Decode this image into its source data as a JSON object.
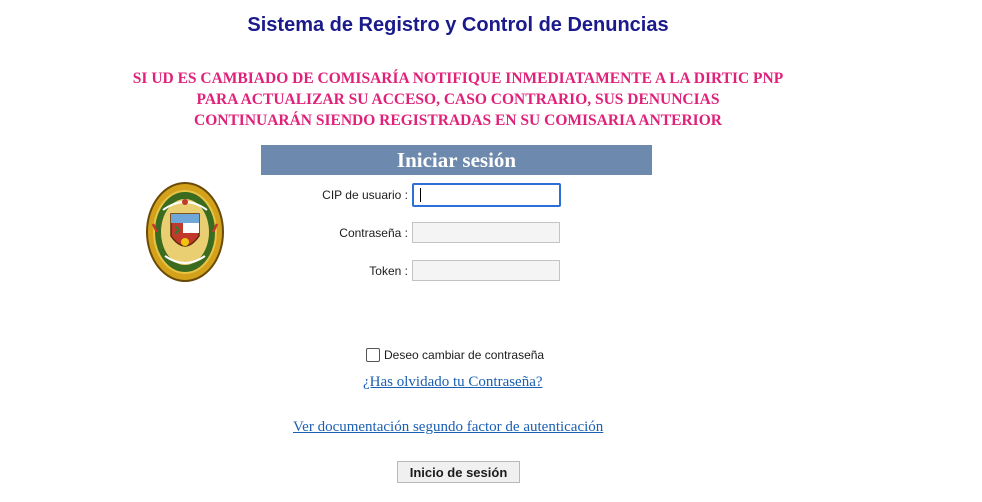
{
  "header": {
    "app_title": "Sistema de Registro y Control de Denuncias"
  },
  "notice": {
    "lines": [
      "SI UD ES CAMBIADO DE COMISARÍA NOTIFIQUE INMEDIATAMENTE  A LA DIRTIC PNP",
      "PARA ACTUALIZAR SU ACCESO, CASO CONTRARIO,  SUS DENUNCIAS",
      "CONTINUARÁN SIENDO REGISTRADAS EN SU COMISARIA ANTERIOR"
    ],
    "color": "#e0217a"
  },
  "login": {
    "header_title": "Iniciar sesión",
    "header_color": "#6d89ad",
    "fields": {
      "user": {
        "label": "CIP de usuario :",
        "value": ""
      },
      "password": {
        "label": "Contraseña :",
        "value": ""
      },
      "token": {
        "label": "Token :",
        "value": ""
      }
    },
    "change_password_label": "Deseo cambiar de contraseña",
    "change_password_checked": false,
    "forgot_password_link": "¿Has olvidado tu Contraseña?",
    "docs_link": "Ver documentación segundo factor de autenticación",
    "submit_label": "Inicio de sesión"
  },
  "emblem": {
    "icon": "police-emblem-icon"
  },
  "colors": {
    "title": "#1a1a8c",
    "link": "#1a5fb4"
  }
}
